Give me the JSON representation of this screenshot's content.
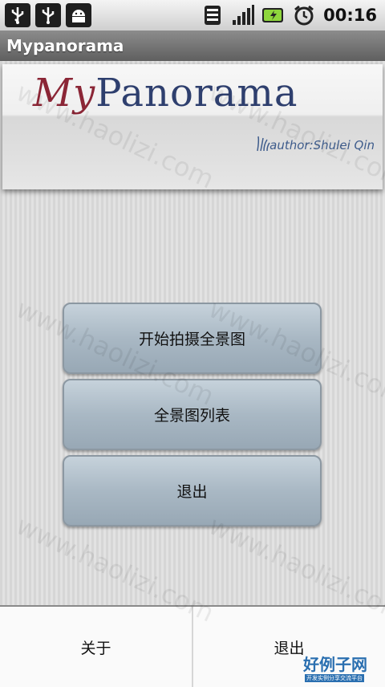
{
  "status_bar": {
    "left_icons": [
      "usb-icon",
      "usb-icon",
      "android-debug-icon"
    ],
    "right_icons": [
      "wifi-icon",
      "signal-icon",
      "battery-charging-icon",
      "alarm-clock-icon"
    ],
    "time": "00:16"
  },
  "app": {
    "title": "Mypanorama"
  },
  "banner": {
    "logo_my": "My",
    "logo_panorama": "Panorama",
    "author": "author:Shulei Qin"
  },
  "buttons": {
    "start": "开始拍摄全景图",
    "list": "全景图列表",
    "exit": "退出"
  },
  "menu": {
    "about": "关于",
    "exit": "退出"
  },
  "watermark": {
    "text": "www.haolizi.com",
    "brand": "好例子网",
    "brand_sub": "开发实例分享交流平台"
  }
}
